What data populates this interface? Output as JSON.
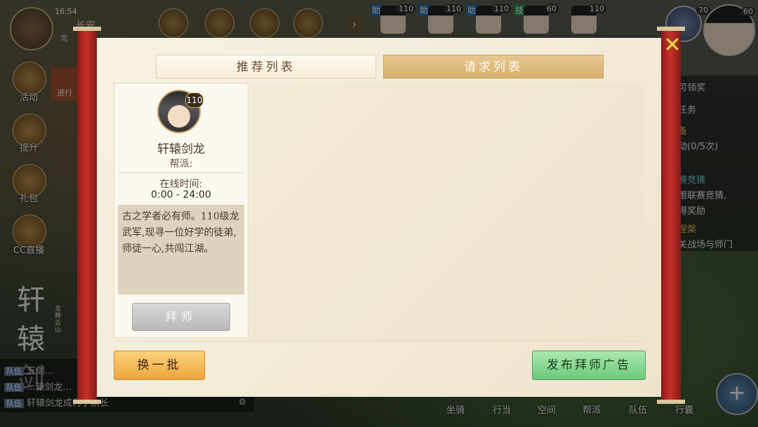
{
  "hud": {
    "time": "16:54",
    "city": "长安",
    "compass": "北"
  },
  "party": [
    {
      "tag": "助",
      "level": "110"
    },
    {
      "tag": "助",
      "level": "110"
    },
    {
      "tag": "助",
      "level": "110"
    },
    {
      "tag": "技",
      "level": "60"
    },
    {
      "tag": "",
      "level": "110"
    }
  ],
  "portraits": {
    "small_level": "70",
    "big_level": "60"
  },
  "side_menu": {
    "activity": "活动",
    "upgrade": "提升",
    "gift": "礼包",
    "cc_live": "CC直播",
    "in_progress": "进行"
  },
  "logo": {
    "text": "轩辕剑",
    "seal": "龙舞云山"
  },
  "chat": [
    {
      "channel": "队伍",
      "text": "五剑..."
    },
    {
      "channel": "队伍",
      "text": "...辕剑龙..."
    },
    {
      "channel": "队伍",
      "text": "轩辕剑龙成为了队长"
    }
  ],
  "quests": {
    "claimable": "可领奖",
    "task": "任务",
    "line1": "备",
    "line2": "动(0/5次)",
    "line3": "赛竞猜",
    "line4": "跟联赛竞猜,",
    "line5": "得奖励",
    "line6": "涅槃",
    "line7": "关战场与师门"
  },
  "bottom_menu": [
    "坐骑",
    "行当",
    "空间",
    "帮派",
    "队伍",
    "行囊"
  ],
  "dialog": {
    "tabs": {
      "recommended": "推荐列表",
      "requests": "请求列表"
    },
    "card": {
      "level": "110",
      "name": "轩辕剑龙",
      "guild_label": "帮派:",
      "online_label": "在线时间:",
      "online_value": "0:00 - 24:00",
      "description": "古之学者必有师。110级龙武军,现寻一位好学的徒弟,师徒一心,共闯江湖。",
      "apprentice_button": "拜师"
    },
    "refresh_button": "换一批",
    "publish_button": "发布拜师广告",
    "close": "✕"
  }
}
